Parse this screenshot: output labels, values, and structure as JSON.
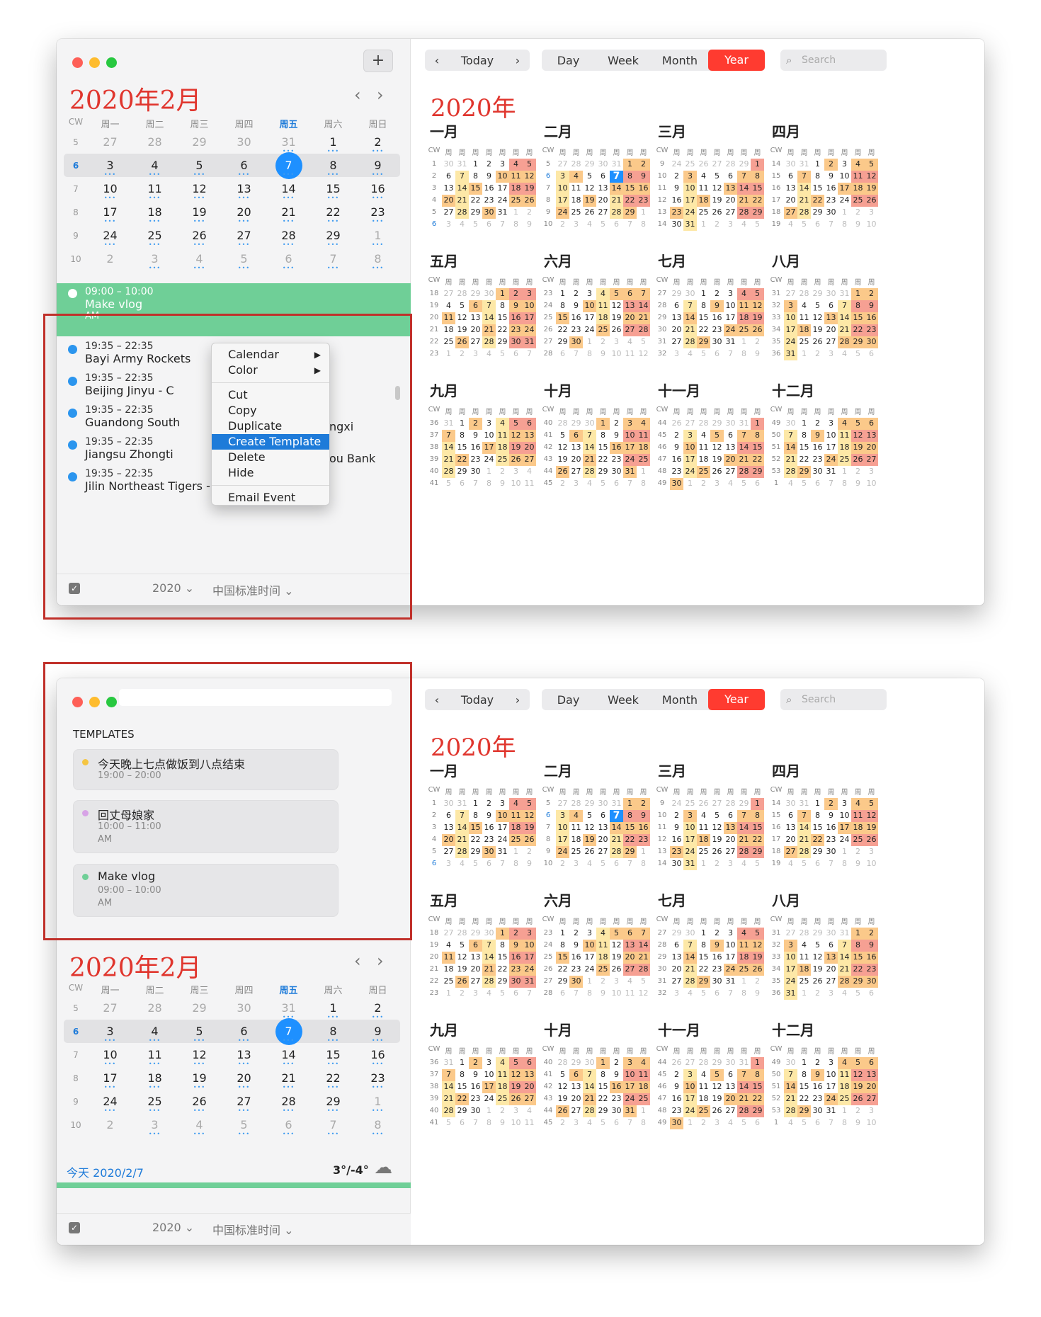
{
  "colors": {
    "accent_red": "#e0362e",
    "event_green": "#6fcf97",
    "select_blue": "#1e90ff"
  },
  "mini": {
    "title": "2020年2月",
    "prev_icon": "chevron-left-icon",
    "next_icon": "chevron-right-icon",
    "header": [
      "CW",
      "周一",
      "周二",
      "周三",
      "周四",
      "周五",
      "周六",
      "周日"
    ],
    "rows": [
      {
        "cw": "5",
        "days": [
          "27",
          "28",
          "29",
          "30",
          "31",
          "1",
          "2"
        ]
      },
      {
        "cw": "6",
        "days": [
          "3",
          "4",
          "5",
          "6",
          "7",
          "8",
          "9"
        ]
      },
      {
        "cw": "7",
        "days": [
          "10",
          "11",
          "12",
          "13",
          "14",
          "15",
          "16"
        ]
      },
      {
        "cw": "8",
        "days": [
          "17",
          "18",
          "19",
          "20",
          "21",
          "22",
          "23"
        ]
      },
      {
        "cw": "9",
        "days": [
          "24",
          "25",
          "26",
          "27",
          "28",
          "29",
          "1"
        ]
      },
      {
        "cw": "10",
        "days": [
          "2",
          "3",
          "4",
          "5",
          "6",
          "7",
          "8"
        ]
      }
    ],
    "today_label": "今天 2020/2/7",
    "weather": "3°/-4°"
  },
  "events": [
    {
      "time": "09:00 – 10:00",
      "title": "Make vlog",
      "ampm": "AM"
    },
    {
      "time": "19:35 – 22:35",
      "title": "Bayi Army Rockets"
    },
    {
      "time": "19:35 – 22:35",
      "title": "Beijing Jinyu - C"
    },
    {
      "time": "19:35 – 22:35",
      "title": "Guandong South",
      "tail": "ngxi"
    },
    {
      "time": "19:35 – 22:35",
      "title": "Jiangsu Zhongti",
      "tail": "ou Bank"
    },
    {
      "time": "19:35 – 22:35",
      "title": "Jilin Northeast Tigers - Sichuan Jinqiang"
    }
  ],
  "context_menu": {
    "calendar": "Calendar",
    "color": "Color",
    "cut": "Cut",
    "copy": "Copy",
    "duplicate": "Duplicate",
    "create_template": "Create Template",
    "delete": "Delete",
    "hide": "Hide",
    "email_event": "Email Event"
  },
  "footer": {
    "year": "2020 ⌄",
    "timezone": "中国标准时间 ⌄"
  },
  "toolbar": {
    "today": "Today",
    "day": "Day",
    "week": "Week",
    "month": "Month",
    "year": "Year",
    "search_placeholder": "Search"
  },
  "year_title": "2020年",
  "year_months": [
    {
      "name": "一月",
      "weeks": [
        [
          "1",
          "30",
          "31",
          "1",
          "2",
          "3",
          "4",
          "5"
        ],
        [
          "2",
          "6",
          "7",
          "8",
          "9",
          "10",
          "11",
          "12"
        ],
        [
          "3",
          "13",
          "14",
          "15",
          "16",
          "17",
          "18",
          "19"
        ],
        [
          "4",
          "20",
          "21",
          "22",
          "23",
          "24",
          "25",
          "26"
        ],
        [
          "5",
          "27",
          "28",
          "29",
          "30",
          "31",
          "1",
          "2"
        ],
        [
          "6",
          "3",
          "4",
          "5",
          "6",
          "7",
          "8",
          "9"
        ]
      ]
    },
    {
      "name": "二月",
      "weeks": [
        [
          "5",
          "27",
          "28",
          "29",
          "30",
          "31",
          "1",
          "2"
        ],
        [
          "6",
          "3",
          "4",
          "5",
          "6",
          "7",
          "8",
          "9"
        ],
        [
          "7",
          "10",
          "11",
          "12",
          "13",
          "14",
          "15",
          "16"
        ],
        [
          "8",
          "17",
          "18",
          "19",
          "20",
          "21",
          "22",
          "23"
        ],
        [
          "9",
          "24",
          "25",
          "26",
          "27",
          "28",
          "29",
          "1"
        ],
        [
          "10",
          "2",
          "3",
          "4",
          "5",
          "6",
          "7",
          "8"
        ]
      ]
    },
    {
      "name": "三月",
      "weeks": [
        [
          "9",
          "24",
          "25",
          "26",
          "27",
          "28",
          "29",
          "1"
        ],
        [
          "10",
          "2",
          "3",
          "4",
          "5",
          "6",
          "7",
          "8"
        ],
        [
          "11",
          "9",
          "10",
          "11",
          "12",
          "13",
          "14",
          "15"
        ],
        [
          "12",
          "16",
          "17",
          "18",
          "19",
          "20",
          "21",
          "22"
        ],
        [
          "13",
          "23",
          "24",
          "25",
          "26",
          "27",
          "28",
          "29"
        ],
        [
          "14",
          "30",
          "31",
          "1",
          "2",
          "3",
          "4",
          "5"
        ]
      ]
    },
    {
      "name": "四月",
      "weeks": [
        [
          "14",
          "30",
          "31",
          "1",
          "2",
          "3",
          "4",
          "5"
        ],
        [
          "15",
          "6",
          "7",
          "8",
          "9",
          "10",
          "11",
          "12"
        ],
        [
          "16",
          "13",
          "14",
          "15",
          "16",
          "17",
          "18",
          "19"
        ],
        [
          "17",
          "20",
          "21",
          "22",
          "23",
          "24",
          "25",
          "26"
        ],
        [
          "18",
          "27",
          "28",
          "29",
          "30",
          "1",
          "2",
          "3"
        ],
        [
          "19",
          "4",
          "5",
          "6",
          "7",
          "8",
          "9",
          "10"
        ]
      ]
    },
    {
      "name": "五月",
      "weeks": [
        [
          "18",
          "27",
          "28",
          "29",
          "30",
          "1",
          "2",
          "3"
        ],
        [
          "19",
          "4",
          "5",
          "6",
          "7",
          "8",
          "9",
          "10"
        ],
        [
          "20",
          "11",
          "12",
          "13",
          "14",
          "15",
          "16",
          "17"
        ],
        [
          "21",
          "18",
          "19",
          "20",
          "21",
          "22",
          "23",
          "24"
        ],
        [
          "22",
          "25",
          "26",
          "27",
          "28",
          "29",
          "30",
          "31"
        ],
        [
          "23",
          "1",
          "2",
          "3",
          "4",
          "5",
          "6",
          "7"
        ]
      ]
    },
    {
      "name": "六月",
      "weeks": [
        [
          "23",
          "1",
          "2",
          "3",
          "4",
          "5",
          "6",
          "7"
        ],
        [
          "24",
          "8",
          "9",
          "10",
          "11",
          "12",
          "13",
          "14"
        ],
        [
          "25",
          "15",
          "16",
          "17",
          "18",
          "19",
          "20",
          "21"
        ],
        [
          "26",
          "22",
          "23",
          "24",
          "25",
          "26",
          "27",
          "28"
        ],
        [
          "27",
          "29",
          "30",
          "1",
          "2",
          "3",
          "4",
          "5"
        ],
        [
          "28",
          "6",
          "7",
          "8",
          "9",
          "10",
          "11",
          "12"
        ]
      ]
    },
    {
      "name": "七月",
      "weeks": [
        [
          "27",
          "29",
          "30",
          "1",
          "2",
          "3",
          "4",
          "5"
        ],
        [
          "28",
          "6",
          "7",
          "8",
          "9",
          "10",
          "11",
          "12"
        ],
        [
          "29",
          "13",
          "14",
          "15",
          "16",
          "17",
          "18",
          "19"
        ],
        [
          "30",
          "20",
          "21",
          "22",
          "23",
          "24",
          "25",
          "26"
        ],
        [
          "31",
          "27",
          "28",
          "29",
          "30",
          "31",
          "1",
          "2"
        ],
        [
          "32",
          "3",
          "4",
          "5",
          "6",
          "7",
          "8",
          "9"
        ]
      ]
    },
    {
      "name": "八月",
      "weeks": [
        [
          "31",
          "27",
          "28",
          "29",
          "30",
          "31",
          "1",
          "2"
        ],
        [
          "32",
          "3",
          "4",
          "5",
          "6",
          "7",
          "8",
          "9"
        ],
        [
          "33",
          "10",
          "11",
          "12",
          "13",
          "14",
          "15",
          "16"
        ],
        [
          "34",
          "17",
          "18",
          "19",
          "20",
          "21",
          "22",
          "23"
        ],
        [
          "35",
          "24",
          "25",
          "26",
          "27",
          "28",
          "29",
          "30"
        ],
        [
          "36",
          "31",
          "1",
          "2",
          "3",
          "4",
          "5",
          "6"
        ]
      ]
    },
    {
      "name": "九月",
      "weeks": [
        [
          "36",
          "31",
          "1",
          "2",
          "3",
          "4",
          "5",
          "6"
        ],
        [
          "37",
          "7",
          "8",
          "9",
          "10",
          "11",
          "12",
          "13"
        ],
        [
          "38",
          "14",
          "15",
          "16",
          "17",
          "18",
          "19",
          "20"
        ],
        [
          "39",
          "21",
          "22",
          "23",
          "24",
          "25",
          "26",
          "27"
        ],
        [
          "40",
          "28",
          "29",
          "30",
          "1",
          "2",
          "3",
          "4"
        ],
        [
          "41",
          "5",
          "6",
          "7",
          "8",
          "9",
          "10",
          "11"
        ]
      ]
    },
    {
      "name": "十月",
      "weeks": [
        [
          "40",
          "28",
          "29",
          "30",
          "1",
          "2",
          "3",
          "4"
        ],
        [
          "41",
          "5",
          "6",
          "7",
          "8",
          "9",
          "10",
          "11"
        ],
        [
          "42",
          "12",
          "13",
          "14",
          "15",
          "16",
          "17",
          "18"
        ],
        [
          "43",
          "19",
          "20",
          "21",
          "22",
          "23",
          "24",
          "25"
        ],
        [
          "44",
          "26",
          "27",
          "28",
          "29",
          "30",
          "31",
          "1"
        ],
        [
          "45",
          "2",
          "3",
          "4",
          "5",
          "6",
          "7",
          "8"
        ]
      ]
    },
    {
      "name": "十一月",
      "weeks": [
        [
          "44",
          "26",
          "27",
          "28",
          "29",
          "30",
          "31",
          "1"
        ],
        [
          "45",
          "2",
          "3",
          "4",
          "5",
          "6",
          "7",
          "8"
        ],
        [
          "46",
          "9",
          "10",
          "11",
          "12",
          "13",
          "14",
          "15"
        ],
        [
          "47",
          "16",
          "17",
          "18",
          "19",
          "20",
          "21",
          "22"
        ],
        [
          "48",
          "23",
          "24",
          "25",
          "26",
          "27",
          "28",
          "29"
        ],
        [
          "49",
          "30",
          "1",
          "2",
          "3",
          "4",
          "5",
          "6"
        ]
      ]
    },
    {
      "name": "十二月",
      "weeks": [
        [
          "49",
          "30",
          "1",
          "2",
          "3",
          "4",
          "5",
          "6"
        ],
        [
          "50",
          "7",
          "8",
          "9",
          "10",
          "11",
          "12",
          "13"
        ],
        [
          "51",
          "14",
          "15",
          "16",
          "17",
          "18",
          "19",
          "20"
        ],
        [
          "52",
          "21",
          "22",
          "23",
          "24",
          "25",
          "26",
          "27"
        ],
        [
          "53",
          "28",
          "29",
          "30",
          "31",
          "1",
          "2",
          "3"
        ],
        [
          "1",
          "4",
          "5",
          "6",
          "7",
          "8",
          "9",
          "10"
        ]
      ]
    }
  ],
  "year_week_header": [
    "CW",
    "周",
    "周",
    "周",
    "周",
    "周",
    "周",
    "周"
  ],
  "templates": {
    "heading": "TEMPLATES",
    "items": [
      {
        "title": "今天晚上七点做饭到八点结束",
        "time": "19:00 – 20:00",
        "color": "#f5c542"
      },
      {
        "title": "回丈母娘家",
        "time": "10:00 – 11:00",
        "ampm": "AM",
        "color": "#d7a3e6"
      },
      {
        "title": "Make vlog",
        "time": "09:00 – 10:00",
        "ampm": "AM",
        "color": "#6fcf97"
      }
    ]
  }
}
